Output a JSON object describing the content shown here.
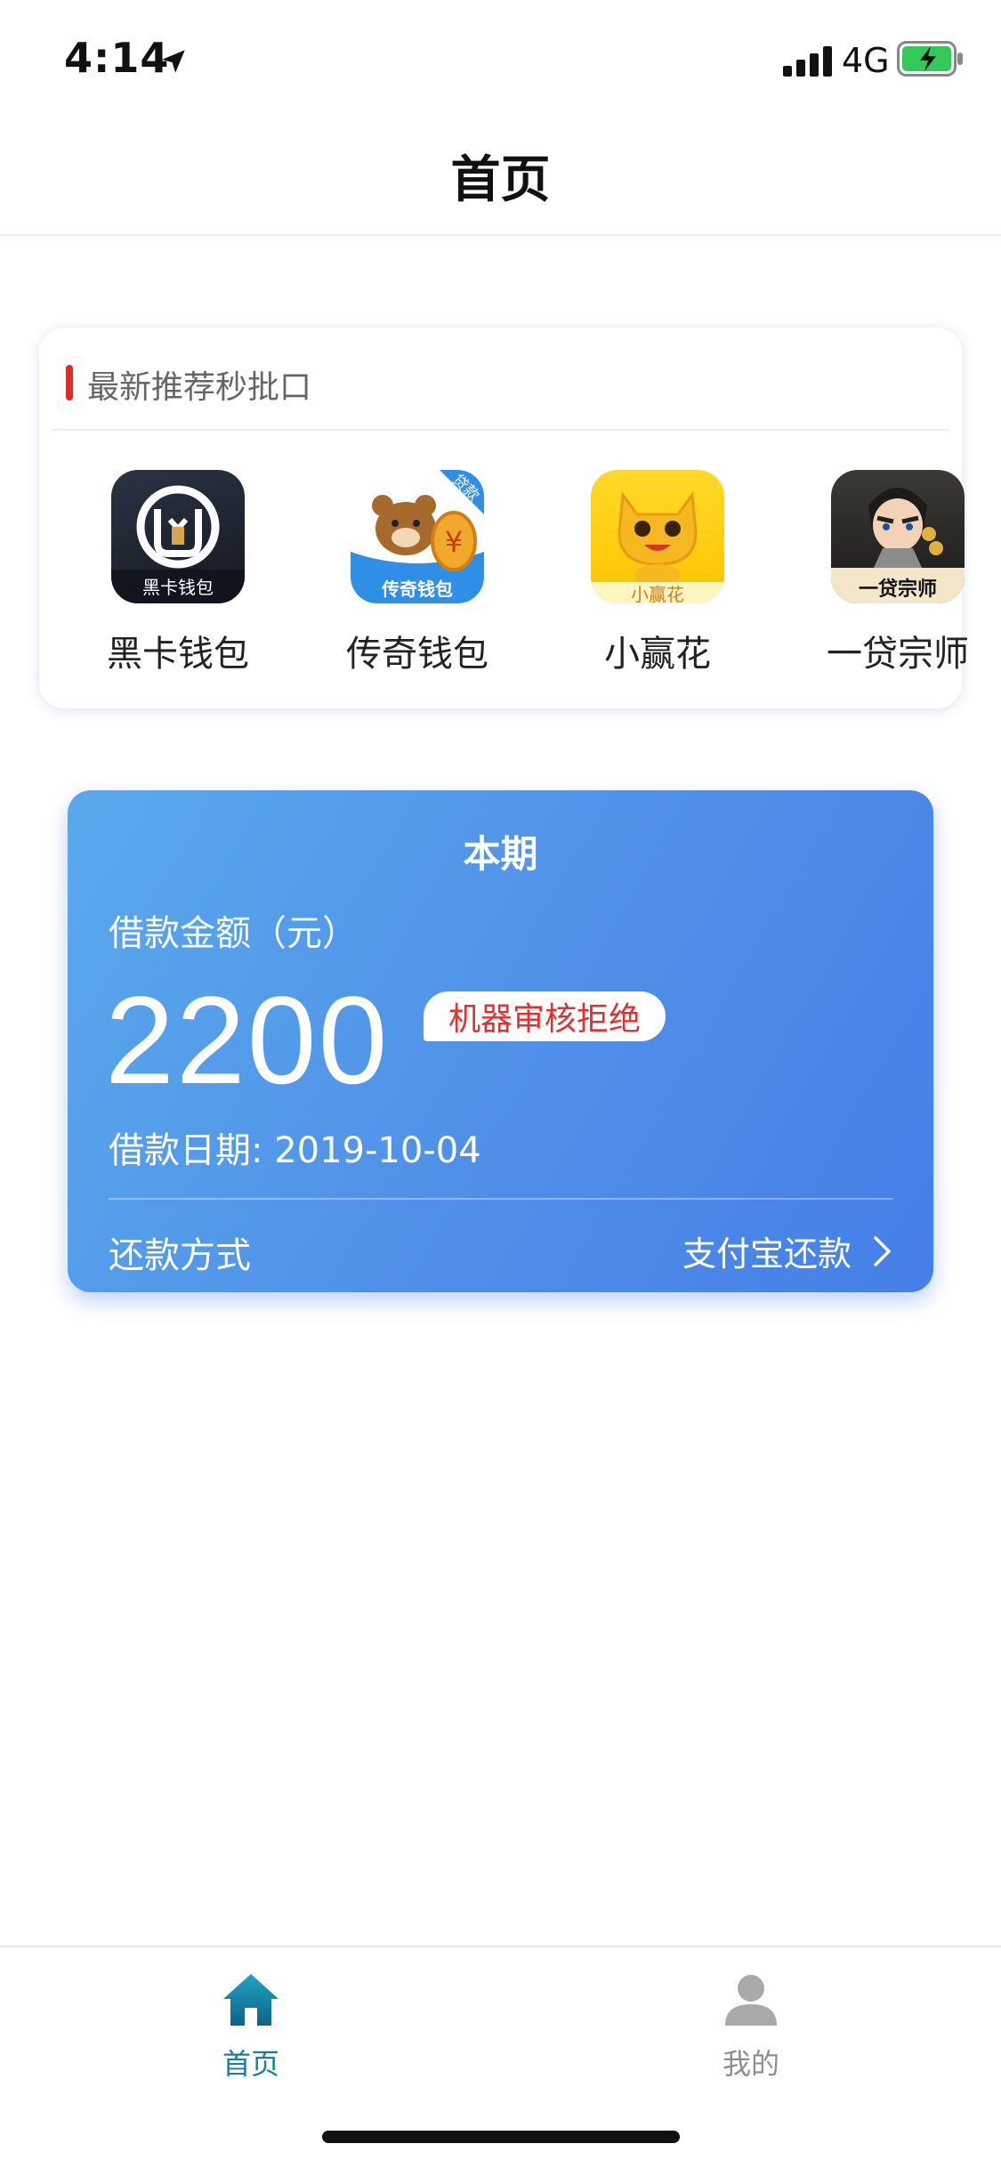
{
  "status_bar": {
    "time": "4:14",
    "network": "4G"
  },
  "nav": {
    "title": "首页"
  },
  "recommend": {
    "title": "最新推荐秒批口",
    "apps": [
      {
        "name": "黑卡钱包",
        "icon_text": "黑卡钱包",
        "icon": "black-card-wallet-icon"
      },
      {
        "name": "传奇钱包",
        "icon_text": "传奇钱包",
        "badge": "贷款",
        "icon": "bear-coin-icon"
      },
      {
        "name": "小赢花",
        "icon_text": "小赢花",
        "icon": "yellow-cat-icon"
      },
      {
        "name": "一贷宗师",
        "icon_text": "一贷宗师",
        "icon": "kungfu-master-icon"
      }
    ]
  },
  "loan": {
    "period": "本期",
    "amount_label": "借款金额（元）",
    "amount": "2200",
    "status": "机器审核拒绝",
    "date": "借款日期: 2019-10-04",
    "repay_label": "还款方式",
    "repay_method": "支付宝还款"
  },
  "tabs": [
    {
      "label": "首页",
      "icon": "home-icon",
      "active": true
    },
    {
      "label": "我的",
      "icon": "person-icon",
      "active": false
    }
  ],
  "colors": {
    "accent": "#1a7ea1",
    "card_start": "#5aa9ec",
    "card_end": "#457fe8",
    "status_red": "#e03030",
    "indicator_red": "#e02a2a"
  }
}
